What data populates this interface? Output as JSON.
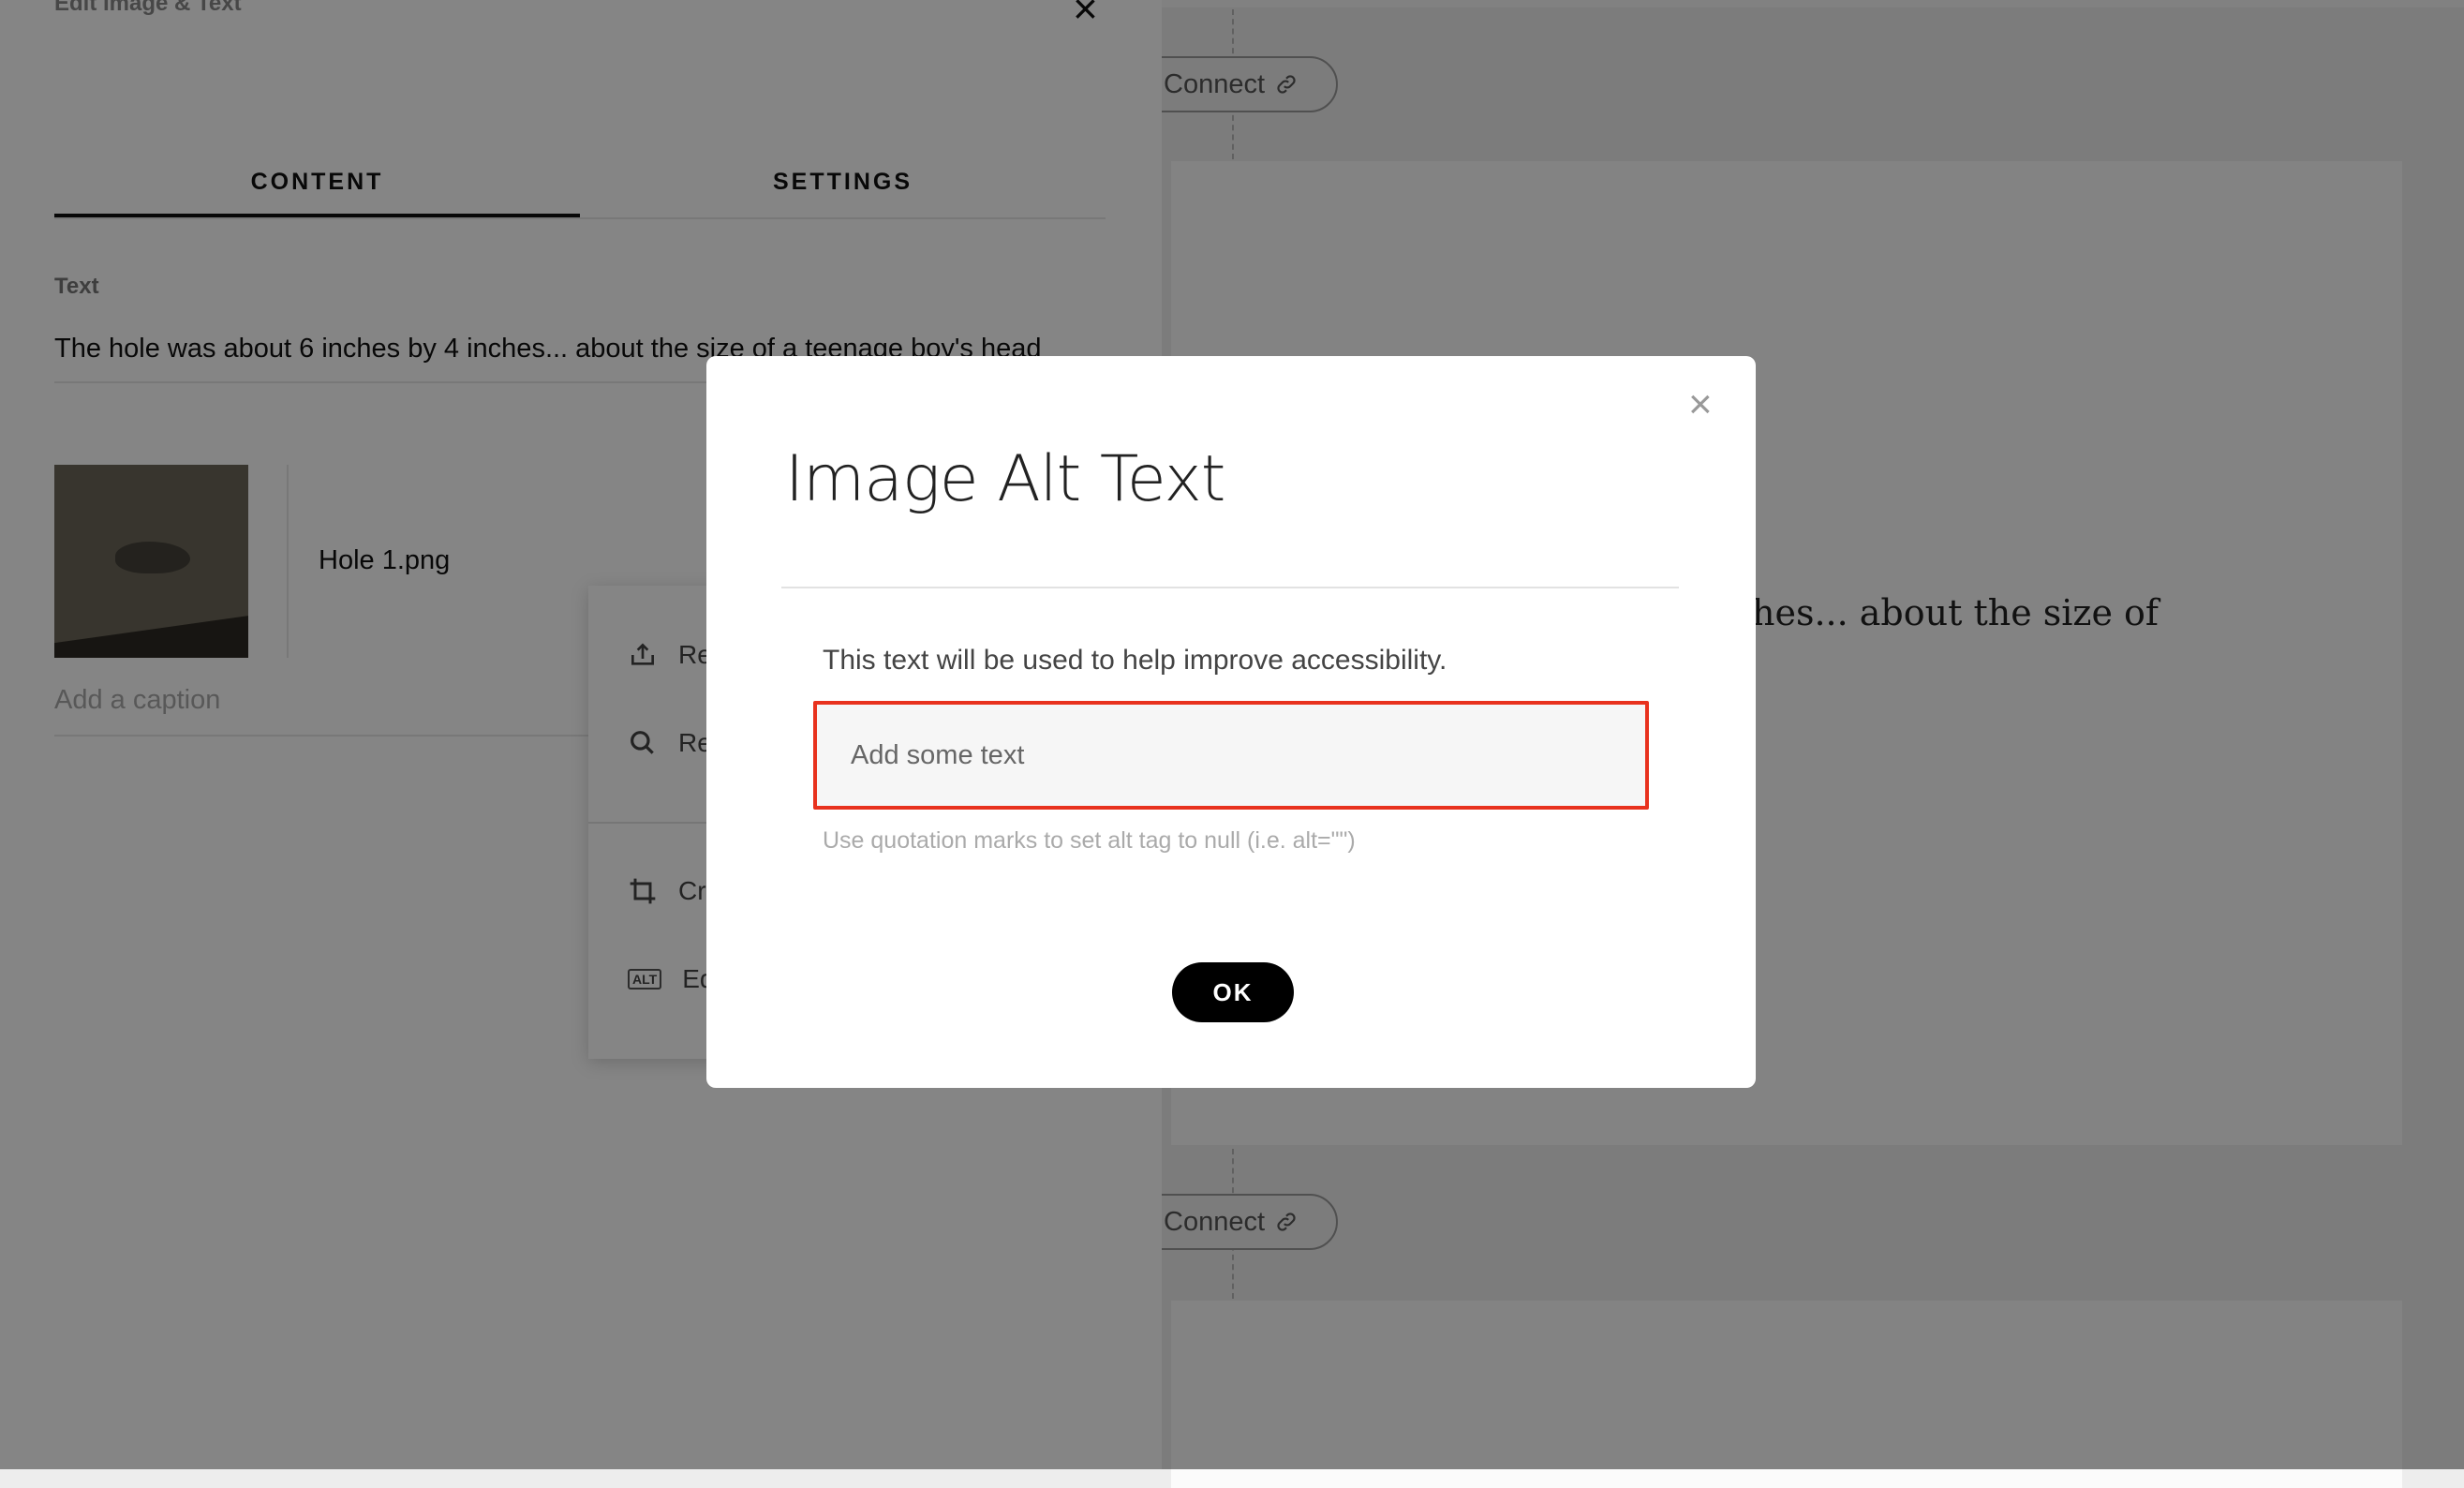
{
  "panel": {
    "title": "Edit Image & Text",
    "close_icon": "×",
    "tabs": [
      {
        "label": "CONTENT",
        "active": true
      },
      {
        "label": "SETTINGS",
        "active": false
      }
    ],
    "text_label": "Text",
    "text_value": "The hole was about 6 inches by 4 inches... about the size of a teenage boy's head",
    "image_file": "Hole 1.png",
    "caption_placeholder": "Add a caption",
    "menu": {
      "items": [
        {
          "label": "Re",
          "icon": "upload-icon"
        },
        {
          "label": "Re",
          "icon": "search-icon"
        },
        {
          "label": "Cr",
          "icon": "crop-icon"
        },
        {
          "label": "Ed",
          "icon": "alt-text-icon",
          "badge": "ALT"
        }
      ]
    }
  },
  "canvas": {
    "connect_label": "Connect",
    "card_text": "hes... about the size of"
  },
  "modal": {
    "title": "Image Alt Text",
    "close_icon": "×",
    "description": "This text will be used to help improve accessibility.",
    "input_placeholder": "Add some text",
    "input_value": "",
    "hint": "Use quotation marks to set alt tag to null (i.e. alt=\"\")",
    "ok_label": "OK",
    "highlight_color": "#e8321e"
  }
}
